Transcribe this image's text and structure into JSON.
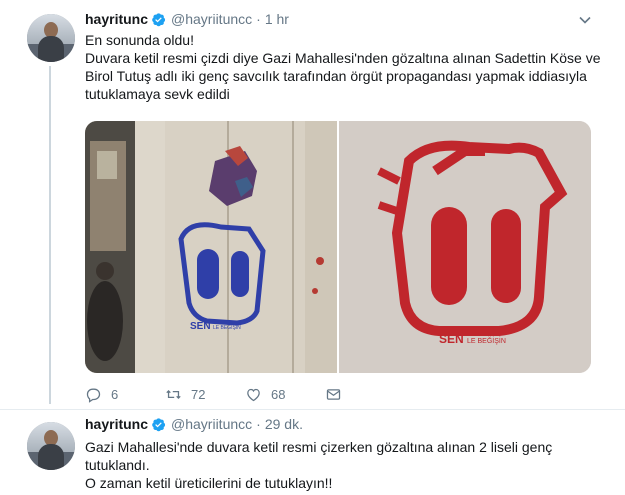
{
  "tweets": [
    {
      "author_name": "hayritunc",
      "handle": "@hayriituncc",
      "separator": "·",
      "time": "1 hr",
      "text": "En sonunda oldu!\nDuvara ketil resmi çizdi diye Gazi Mahallesi'nden gözaltına alınan Sadettin Köse ve Birol Tutuş adlı iki genç savcılık tarafından örgüt propagandası yapmak iddiasıyla tutuklamaya sevk edildi",
      "media": [
        {
          "stencil_text": "SEN",
          "stencil_small": "LE BEĞİŞİN",
          "stencil_color": "#2f3fa8"
        },
        {
          "stencil_text": "SEN",
          "stencil_small": "LE BEĞİŞİN",
          "stencil_color": "#c0262c"
        }
      ],
      "actions": {
        "replies": "6",
        "retweets": "72",
        "likes": "68"
      }
    },
    {
      "author_name": "hayritunc",
      "handle": "@hayriituncc",
      "separator": "·",
      "time": "29 dk.",
      "text": "Gazi Mahallesi'nde duvara ketil resmi çizerken gözaltına alınan 2 liseli genç tutuklandı.\nO zaman ketil üreticilerini de tutuklayın!!"
    }
  ],
  "icons": {
    "verified": "verified-badge-icon",
    "caret": "chevron-down-icon",
    "reply": "reply-icon",
    "retweet": "retweet-icon",
    "like": "heart-icon",
    "dm": "envelope-icon"
  },
  "colors": {
    "verified": "#1da1f2",
    "text": "#14171a",
    "muted": "#657786",
    "divider": "#e6ecf0",
    "thread": "#ccd6dd"
  }
}
